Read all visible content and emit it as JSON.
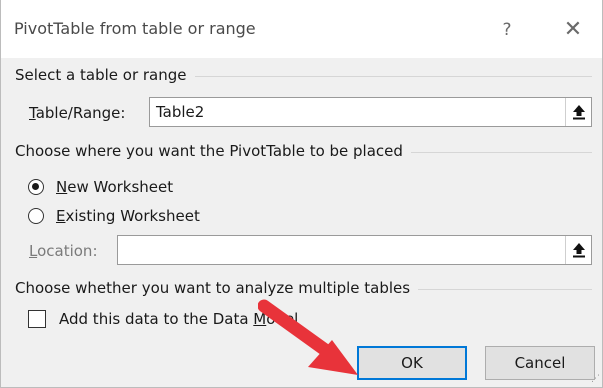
{
  "dialog": {
    "title": "PivotTable from table or range",
    "help_glyph": "?",
    "close_glyph": "✕"
  },
  "source_section": {
    "heading": "Select a table or range",
    "table_range_label_ul": "T",
    "table_range_label_rest": "able/Range:",
    "table_range_value": "Table2"
  },
  "placement_section": {
    "heading": "Choose where you want the PivotTable to be placed",
    "options": [
      {
        "label_ul": "N",
        "label_rest": "ew Worksheet",
        "selected": true
      },
      {
        "label_ul": "E",
        "label_rest": "xisting Worksheet",
        "selected": false
      }
    ],
    "location_label_ul": "L",
    "location_label_rest": "ocation:",
    "location_value": ""
  },
  "analyze_section": {
    "heading": "Choose whether you want to analyze multiple tables",
    "add_to_model_label": "Add this data to the Data ",
    "add_to_model_label_ul": "M",
    "add_to_model_label_tail": "odel",
    "add_to_model_checked": false
  },
  "buttons": {
    "ok": "OK",
    "cancel": "Cancel"
  },
  "annotation": {
    "arrow_color": "#e8333a"
  }
}
